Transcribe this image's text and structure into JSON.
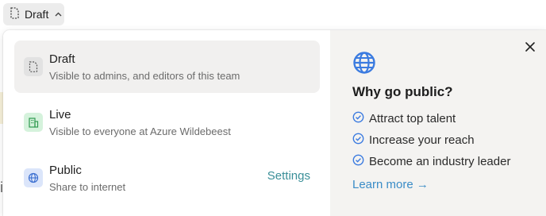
{
  "trigger": {
    "label": "Draft",
    "icon": "draft-doc-icon",
    "chevron": "chevron-up-icon"
  },
  "options": [
    {
      "title": "Draft",
      "description": "Visible to admins, and editors of this team",
      "icon": "draft-doc-icon",
      "selected": true
    },
    {
      "title": "Live",
      "description": "Visible to everyone at Azure Wildebeest",
      "icon": "building-icon",
      "selected": false
    },
    {
      "title": "Public",
      "description": "Share to internet",
      "icon": "globe-icon",
      "link": "Settings",
      "selected": false
    }
  ],
  "info": {
    "title": "Why go public?",
    "benefits": [
      "Attract top talent",
      "Increase your reach",
      "Become an industry leader"
    ],
    "learn_more": "Learn more →"
  },
  "colors": {
    "accent_blue": "#3b7be0",
    "link_teal": "#3a8f98",
    "link_blue": "#3a8cc7",
    "selected_bg": "#f1f0ef",
    "panel_bg": "#f4f3f1"
  }
}
